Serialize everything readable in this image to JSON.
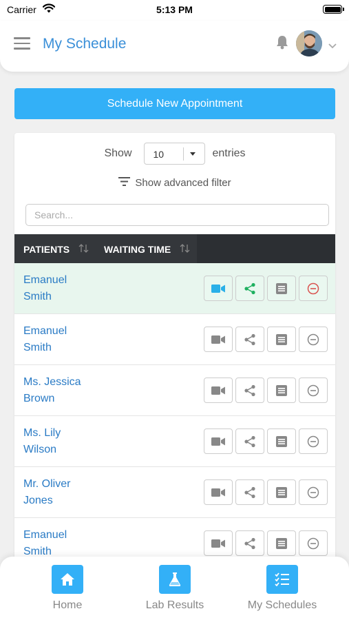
{
  "status_bar": {
    "carrier": "Carrier",
    "time": "5:13 PM"
  },
  "header": {
    "title": "My Schedule"
  },
  "schedule_button_label": "Schedule New Appointment",
  "entries": {
    "show_label": "Show",
    "value": "10",
    "suffix": "entries"
  },
  "filter_label": "Show advanced filter",
  "search": {
    "placeholder": "Search..."
  },
  "table": {
    "columns": [
      "PATIENTS",
      "WAITING TIME"
    ],
    "rows": [
      {
        "line1": "Emanuel",
        "line2": "Smith",
        "active": true
      },
      {
        "line1": "Emanuel",
        "line2": "Smith",
        "active": false
      },
      {
        "line1": "Ms. Jessica",
        "line2": "Brown",
        "active": false
      },
      {
        "line1": "Ms. Lily",
        "line2": "Wilson",
        "active": false
      },
      {
        "line1": "Mr. Oliver",
        "line2": "Jones",
        "active": false
      },
      {
        "line1": "Emanuel",
        "line2": "Smith",
        "active": false
      }
    ]
  },
  "bottom_nav": [
    {
      "label": "Home",
      "icon": "home-icon"
    },
    {
      "label": "Lab Results",
      "icon": "flask-icon"
    },
    {
      "label": "My Schedules",
      "icon": "checklist-icon"
    }
  ],
  "colors": {
    "accent": "#33b0f7",
    "title": "#3a8fd8",
    "link": "#2a7bc5",
    "video_active": "#2ab0e8",
    "share_active": "#1fb060",
    "remove_active": "#d9534f",
    "inactive_icon": "#888888"
  }
}
